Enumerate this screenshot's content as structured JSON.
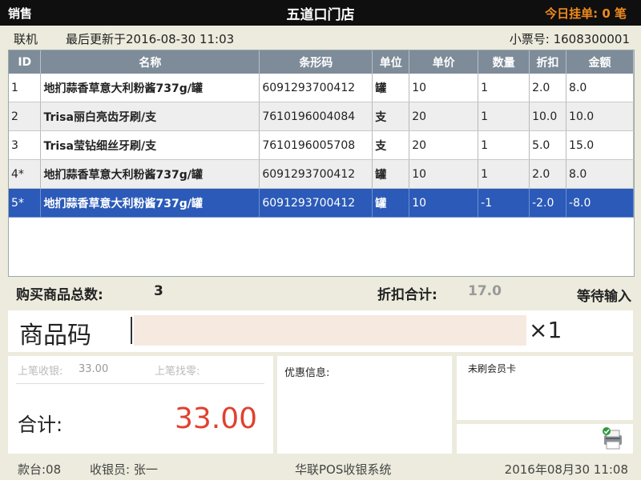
{
  "titlebar": {
    "left": "销售",
    "store": "五道口门店",
    "pending_label": "今日挂单:",
    "pending_count": "0",
    "pending_unit": "笔"
  },
  "infobar": {
    "mode": "联机",
    "updated": "最后更新于2016-08-30 11:03",
    "receipt_label": "小票号:",
    "receipt_no": "1608300001"
  },
  "table": {
    "headers": [
      "ID",
      "名称",
      "条形码",
      "单位",
      "单价",
      "数量",
      "折扣",
      "金额"
    ],
    "rows": [
      [
        "1",
        "地扪蒜香草意大利粉酱737g/罐",
        "6091293700412",
        "罐",
        "10",
        "1",
        "2.0",
        "8.0"
      ],
      [
        "2",
        "Trisa丽白亮齿牙刷/支",
        "7610196004084",
        "支",
        "20",
        "1",
        "10.0",
        "10.0"
      ],
      [
        "3",
        "Trisa莹钻细丝牙刷/支",
        "7610196005708",
        "支",
        "20",
        "1",
        "5.0",
        "15.0"
      ],
      [
        "4*",
        "地扪蒜香草意大利粉酱737g/罐",
        "6091293700412",
        "罐",
        "10",
        "1",
        "2.0",
        "8.0"
      ],
      [
        "5*",
        "地扪蒜香草意大利粉酱737g/罐",
        "6091293700412",
        "罐",
        "10",
        "-1",
        "-2.0",
        "-8.0"
      ]
    ],
    "selected_row": 4
  },
  "summary": {
    "count_label": "购买商品总数:",
    "count_value": "3",
    "discount_label": "折扣合计:",
    "discount_value": "17.0",
    "status": "等待输入"
  },
  "entry": {
    "label": "商品码",
    "value": "",
    "qty": "×1"
  },
  "totals": {
    "last_paid_label": "上笔收银:",
    "last_paid_value": "33.00",
    "last_change_label": "上笔找零:",
    "total_label": "合计:",
    "total_value": "33.00"
  },
  "promo": {
    "label": "优惠信息:"
  },
  "member": {
    "label": "未刷会员卡"
  },
  "printer": {
    "icon": "printer-icon",
    "status_icon": "check-icon"
  },
  "footer": {
    "terminal": "款台:08",
    "cashier": "收银员: 张一",
    "system": "华联POS收银系统",
    "datetime": "2016年08月30 11:08"
  },
  "colors": {
    "titlebar": "#0f0f0f",
    "header": "#7e8b99",
    "selected": "#2b5ab8",
    "total": "#e0412e",
    "pending": "#f08a1c",
    "entry_bg": "#f6e9df"
  }
}
